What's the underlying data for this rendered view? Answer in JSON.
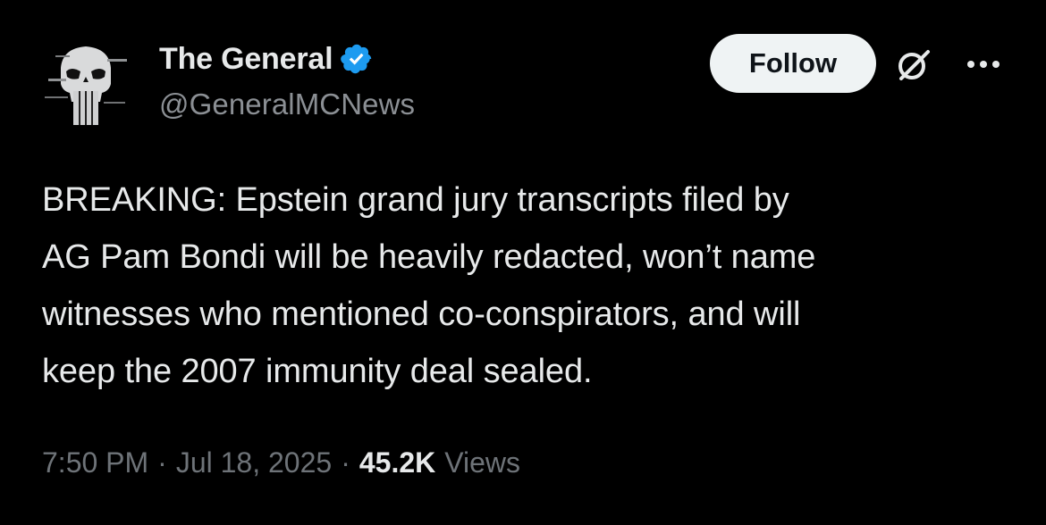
{
  "author": {
    "display_name": "The General",
    "handle": "@GeneralMCNews",
    "verified": true,
    "avatar_icon": "punisher-skull-avatar"
  },
  "actions": {
    "follow_label": "Follow",
    "grok_icon": "grok-icon",
    "more_icon": "more-options-icon"
  },
  "tweet": {
    "text": "BREAKING: Epstein grand jury transcripts filed by\nAG Pam Bondi will be heavily redacted, won’t name\nwitnesses who mentioned co-conspirators, and will\nkeep the 2007 immunity deal sealed."
  },
  "meta": {
    "time": "7:50 PM",
    "date": "Jul 18, 2025",
    "separator": "·",
    "views_count": "45.2K",
    "views_label": "Views"
  },
  "colors": {
    "background": "#000000",
    "text_primary": "#e7e9ea",
    "text_secondary": "#6e7378",
    "verified_blue": "#1d9bf0",
    "follow_bg": "#eff3f4"
  }
}
